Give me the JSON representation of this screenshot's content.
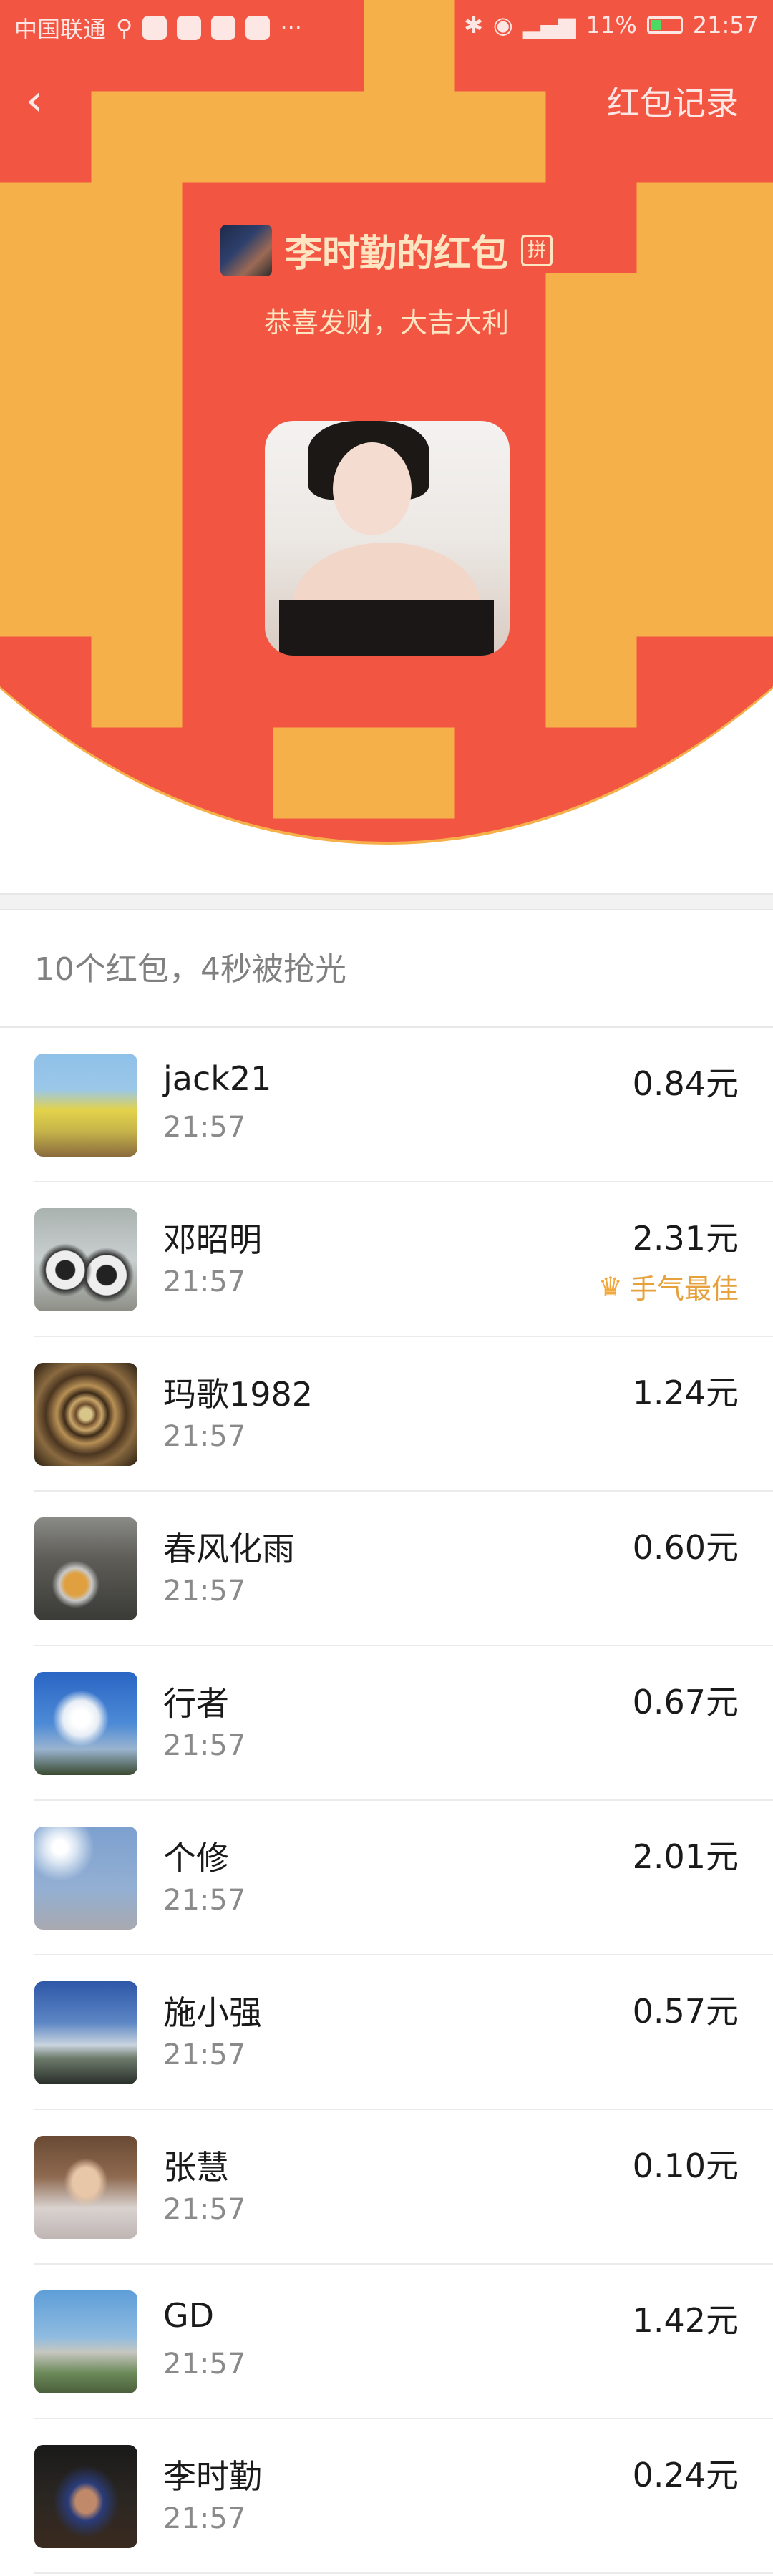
{
  "status_bar": {
    "carrier": "中国联通",
    "usb_icon": "usb-icon",
    "more": "···",
    "battery_percent": "11%",
    "time": "21:57"
  },
  "nav": {
    "back_icon": "chevron-left-icon",
    "record_label": "红包记录"
  },
  "packet": {
    "sender_name": "李时勤的红包",
    "pin_label": "拼",
    "greeting": "恭喜发财，大吉大利"
  },
  "summary": "10个红包，4秒被抢光",
  "records": [
    {
      "name": "jack21",
      "time": "21:57",
      "amount": "0.84元",
      "best": ""
    },
    {
      "name": "邓昭明",
      "time": "21:57",
      "amount": "2.31元",
      "best": "手气最佳"
    },
    {
      "name": "玛歌1982",
      "time": "21:57",
      "amount": "1.24元",
      "best": ""
    },
    {
      "name": "春风化雨",
      "time": "21:57",
      "amount": "0.60元",
      "best": ""
    },
    {
      "name": "行者",
      "time": "21:57",
      "amount": "0.67元",
      "best": ""
    },
    {
      "name": "个修",
      "time": "21:57",
      "amount": "2.01元",
      "best": ""
    },
    {
      "name": "施小强",
      "time": "21:57",
      "amount": "0.57元",
      "best": ""
    },
    {
      "name": "张慧",
      "time": "21:57",
      "amount": "0.10元",
      "best": ""
    },
    {
      "name": "GD",
      "time": "21:57",
      "amount": "1.42元",
      "best": ""
    },
    {
      "name": "李时勤",
      "time": "21:57",
      "amount": "0.24元",
      "best": ""
    }
  ],
  "colors": {
    "header_red": "#f25643",
    "gold_text": "#fde5c2",
    "best_orange": "#e7a13c"
  }
}
